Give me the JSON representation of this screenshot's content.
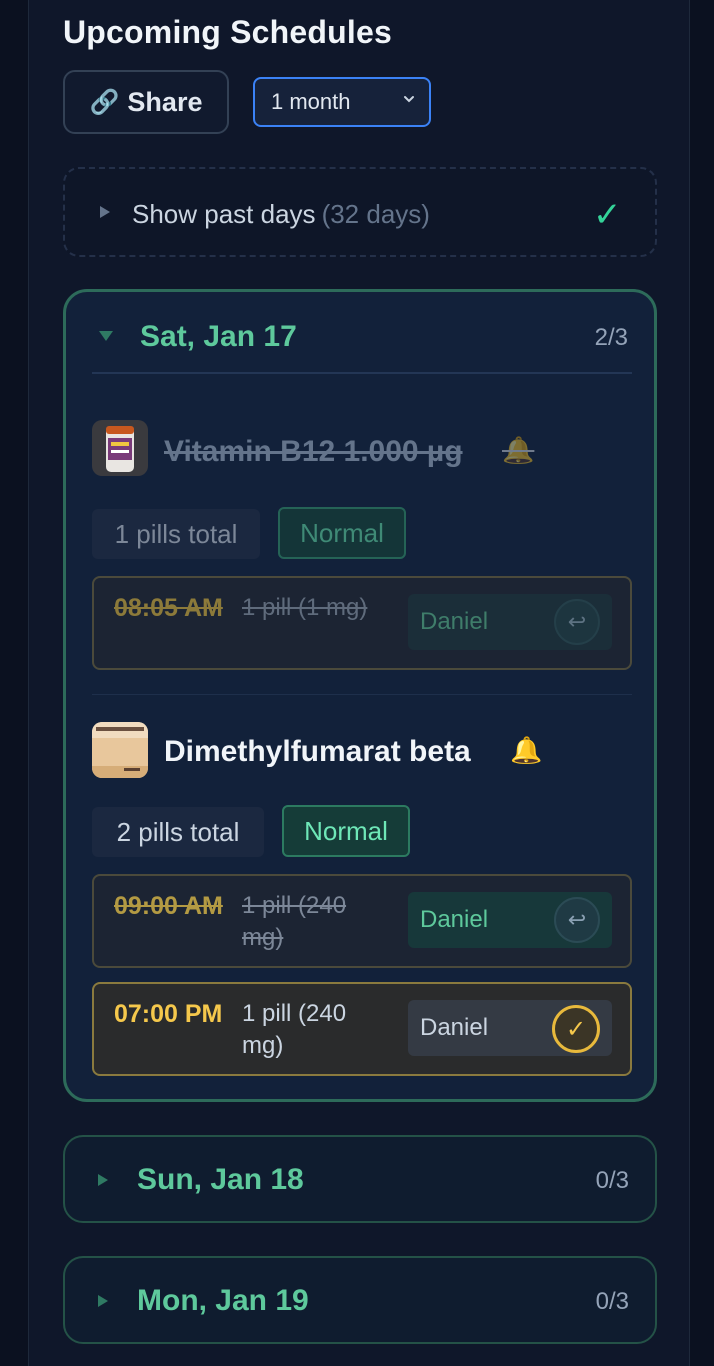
{
  "header": {
    "title": "Upcoming Schedules",
    "share_label": "Share",
    "range_value": "1 month"
  },
  "past_days": {
    "label": "Show past days",
    "count": "(32 days)"
  },
  "days": [
    {
      "date": "Sat, Jan 17",
      "progress": "2/3",
      "expanded": true,
      "medications": [
        {
          "name": "Vitamin B12 1.000 µg",
          "taken": true,
          "pills_total": "1 pills total",
          "priority": "Normal",
          "doses": [
            {
              "time": "08:05 AM",
              "amount": "1 pill (1 mg)",
              "person": "Daniel",
              "status": "taken"
            }
          ]
        },
        {
          "name": "Dimethylfumarat beta",
          "taken": false,
          "pills_total": "2 pills total",
          "priority": "Normal",
          "doses": [
            {
              "time": "09:00 AM",
              "amount": "1 pill (240 mg)",
              "person": "Daniel",
              "status": "taken"
            },
            {
              "time": "07:00 PM",
              "amount": "1 pill (240 mg)",
              "person": "Daniel",
              "status": "pending"
            }
          ]
        }
      ]
    },
    {
      "date": "Sun, Jan 18",
      "progress": "0/3",
      "expanded": false
    },
    {
      "date": "Mon, Jan 19",
      "progress": "0/3",
      "expanded": false
    }
  ],
  "colors": {
    "accent_green": "#5ec99c",
    "pending_yellow": "#f5c84c",
    "select_border": "#3b82f6"
  }
}
